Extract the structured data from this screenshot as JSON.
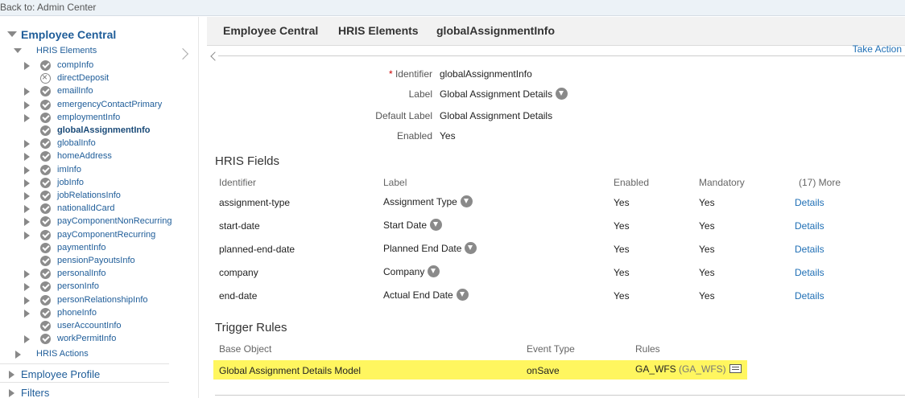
{
  "back_link": "Back to: Admin Center",
  "sidebar": {
    "title": "Employee Central",
    "group": "HRIS Elements",
    "items": [
      {
        "label": "compInfo",
        "icon": "check",
        "expandable": true
      },
      {
        "label": "directDeposit",
        "icon": "cross",
        "expandable": false
      },
      {
        "label": "emailInfo",
        "icon": "check",
        "expandable": true
      },
      {
        "label": "emergencyContactPrimary",
        "icon": "check",
        "expandable": true
      },
      {
        "label": "employmentInfo",
        "icon": "check",
        "expandable": true
      },
      {
        "label": "globalAssignmentInfo",
        "icon": "check",
        "expandable": false,
        "selected": true
      },
      {
        "label": "globalInfo",
        "icon": "check",
        "expandable": true
      },
      {
        "label": "homeAddress",
        "icon": "check",
        "expandable": true
      },
      {
        "label": "imInfo",
        "icon": "check",
        "expandable": true
      },
      {
        "label": "jobInfo",
        "icon": "check",
        "expandable": true
      },
      {
        "label": "jobRelationsInfo",
        "icon": "check",
        "expandable": true
      },
      {
        "label": "nationalIdCard",
        "icon": "check",
        "expandable": true
      },
      {
        "label": "payComponentNonRecurring",
        "icon": "check",
        "expandable": true
      },
      {
        "label": "payComponentRecurring",
        "icon": "check",
        "expandable": true
      },
      {
        "label": "paymentInfo",
        "icon": "check",
        "expandable": false
      },
      {
        "label": "pensionPayoutsInfo",
        "icon": "check",
        "expandable": false
      },
      {
        "label": "personalInfo",
        "icon": "check",
        "expandable": true
      },
      {
        "label": "personInfo",
        "icon": "check",
        "expandable": true
      },
      {
        "label": "personRelationshipInfo",
        "icon": "check",
        "expandable": true
      },
      {
        "label": "phoneInfo",
        "icon": "check",
        "expandable": true
      },
      {
        "label": "userAccountInfo",
        "icon": "check",
        "expandable": false
      },
      {
        "label": "workPermitInfo",
        "icon": "check",
        "expandable": true
      }
    ],
    "hris_actions": "HRIS Actions",
    "employee_profile": "Employee Profile",
    "filters": "Filters"
  },
  "breadcrumb": [
    "Employee Central",
    "HRIS Elements",
    "globalAssignmentInfo"
  ],
  "take_action": "Take Action",
  "details": {
    "required_mark": "*",
    "identifier_label": "Identifier",
    "identifier_value": "globalAssignmentInfo",
    "label_label": "Label",
    "label_value": "Global Assignment Details",
    "default_label_label": "Default Label",
    "default_label_value": "Global Assignment Details",
    "enabled_label": "Enabled",
    "enabled_value": "Yes"
  },
  "hris_fields": {
    "title": "HRIS Fields",
    "headers": {
      "identifier": "Identifier",
      "label": "Label",
      "enabled": "Enabled",
      "mandatory": "Mandatory",
      "more": "(17) More"
    },
    "rows": [
      {
        "identifier": "assignment-type",
        "label": "Assignment Type",
        "enabled": "Yes",
        "mandatory": "Yes",
        "action": "Details"
      },
      {
        "identifier": "start-date",
        "label": "Start Date",
        "enabled": "Yes",
        "mandatory": "Yes",
        "action": "Details"
      },
      {
        "identifier": "planned-end-date",
        "label": "Planned End Date",
        "enabled": "Yes",
        "mandatory": "Yes",
        "action": "Details"
      },
      {
        "identifier": "company",
        "label": "Company",
        "enabled": "Yes",
        "mandatory": "Yes",
        "action": "Details"
      },
      {
        "identifier": "end-date",
        "label": "Actual End Date",
        "enabled": "Yes",
        "mandatory": "Yes",
        "action": "Details"
      }
    ]
  },
  "trigger_rules": {
    "title": "Trigger Rules",
    "headers": {
      "base_object": "Base Object",
      "event_type": "Event Type",
      "rules": "Rules"
    },
    "row": {
      "base_object": "Global Assignment Details Model",
      "event_type": "onSave",
      "rule": "GA_WFS",
      "rule_id": "(GA_WFS)"
    },
    "highlight_color": "#fff65f"
  }
}
